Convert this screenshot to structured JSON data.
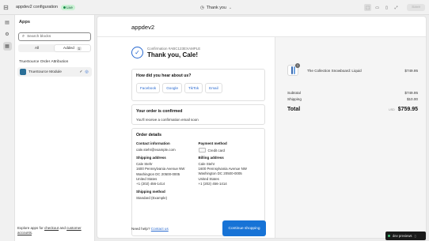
{
  "topbar": {
    "exit_icon": "exit-icon",
    "title": "appdev2 configuration",
    "live_badge": "Live",
    "page_selector": "Thank you",
    "save_label": "Save"
  },
  "sidebar": {
    "header": "Apps",
    "search_placeholder": "Search blocks",
    "tabs": [
      {
        "label": "All"
      },
      {
        "label": "Added",
        "count": "1"
      }
    ],
    "section_title": "TrueSource Order Attribution",
    "block_label": "TrueSource Module",
    "footer_prefix": "Explore apps for",
    "footer_link1": "checkout",
    "footer_and": "and",
    "footer_link2": "customer accounts",
    "footer_suffix": "."
  },
  "preview": {
    "shop_name": "appdev2",
    "confirmation_number": "Confirmation #ABC123EXAMPLE",
    "thanks": "Thank you, Cale!",
    "survey": {
      "title": "How did you hear about us?",
      "options": [
        "Facebook",
        "Google",
        "TikTok",
        "Email"
      ]
    },
    "confirmed": {
      "title": "Your order is confirmed",
      "text": "You'll receive a confirmation email soon"
    },
    "details": {
      "title": "Order details",
      "contact_label": "Contact information",
      "contact_email": "cale.stehr@example.com",
      "shipping_address_label": "Shipping address",
      "shipping_address": [
        "Cale Stehr",
        "1600 Pennsylvania Avenue NW",
        "Washington DC 20500-0005",
        "United States",
        "+1 (202) 456-1414"
      ],
      "shipping_method_label": "Shipping method",
      "shipping_method": "Standard (Example)",
      "payment_label": "Payment method",
      "payment_value": "Credit card",
      "billing_label": "Billing address",
      "billing_address": [
        "Cale Stehr",
        "1600 Pennsylvania Avenue NW",
        "Washington DC 20500-0005",
        "United States",
        "+1 (202) 456-1414"
      ]
    },
    "help_prefix": "Need help?",
    "help_link": "Contact us",
    "continue_label": "Continue shopping",
    "summary": {
      "product_name": "The Collection Snowboard: Liquid",
      "product_qty": "1",
      "product_price": "$749.95",
      "subtotal_label": "Subtotal",
      "subtotal": "$749.95",
      "shipping_label": "Shipping",
      "shipping": "$10.00",
      "total_label": "Total",
      "currency": "USD",
      "total": "$759.95"
    }
  },
  "dev_badge": "dev previews",
  "colors": {
    "accent": "#1773d6",
    "live": "#c9f2d3"
  }
}
